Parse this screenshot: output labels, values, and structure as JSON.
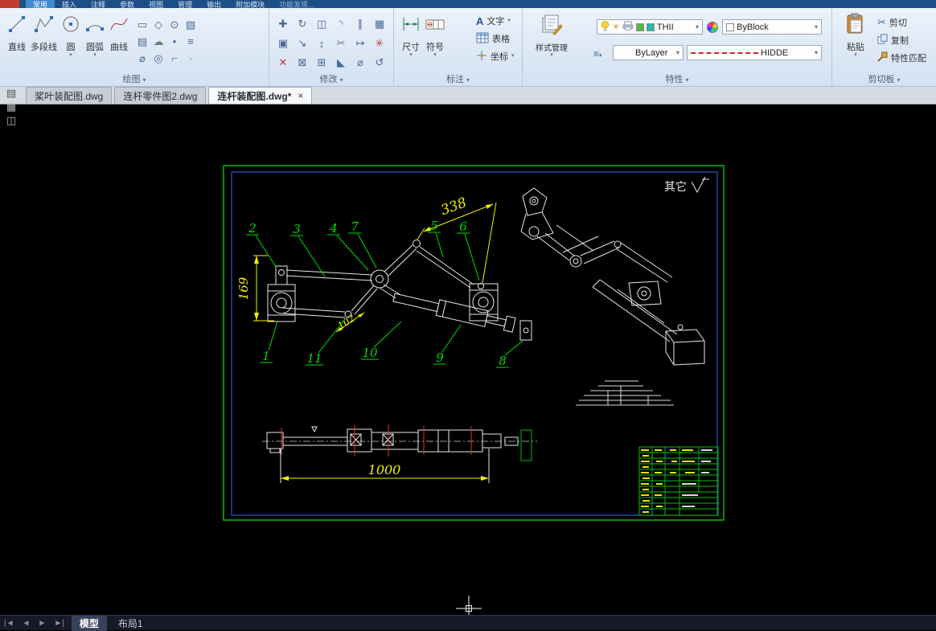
{
  "top_bar": {
    "tabs": [
      {
        "label": "常用",
        "active": true
      },
      {
        "label": "插入",
        "active": false
      },
      {
        "label": "注释",
        "active": false
      },
      {
        "label": "参数",
        "active": false
      },
      {
        "label": "视图",
        "active": false
      },
      {
        "label": "管理",
        "active": false
      },
      {
        "label": "输出",
        "active": false
      },
      {
        "label": "附加模块",
        "active": false
      },
      {
        "label": "功能发现...",
        "active": false
      }
    ]
  },
  "ribbon": {
    "draw": {
      "label": "绘图",
      "line": "直线",
      "polyline": "多段线",
      "circle": "圆",
      "arc": "圆弧",
      "spline": "曲线"
    },
    "modify": {
      "label": "修改"
    },
    "annotate": {
      "label": "标注",
      "dim": "尺寸",
      "symbol": "符号",
      "text": "文字",
      "table": "表格",
      "coord": "坐标"
    },
    "props": {
      "label": "特性",
      "style_mgr": "样式管理",
      "layer": "THII",
      "color": "ByBlock",
      "linetype": "ByLayer",
      "lt2": "HIDDE"
    },
    "clip": {
      "label": "剪切板",
      "paste": "粘贴",
      "cut": "剪切",
      "copy": "复制",
      "match": "特性匹配"
    }
  },
  "file_tabs": {
    "t1": "桨叶装配图.dwg",
    "t2": "连杆零件图2.dwg",
    "t3": "连杆装配图.dwg*",
    "close": "×"
  },
  "drawing": {
    "other": "其它",
    "dims": {
      "d338": "338",
      "d169": "169",
      "d102": "102",
      "d1000": "1000"
    },
    "callouts": {
      "c1": "1",
      "c2": "2",
      "c3": "3",
      "c4": "4",
      "c5": "5",
      "c6": "6",
      "c7": "7",
      "c8": "8",
      "c9": "9",
      "c10": "10",
      "c11": "11"
    }
  },
  "status": {
    "model": "模型",
    "layout1": "布局1"
  },
  "colors": {
    "frame_green": "#00c000",
    "inner_frame_blue": "#2456c8",
    "dim_yellow": "#f2f200",
    "callout_green": "#00dd00",
    "centerline_red": "#e03030",
    "entity_white": "#e8e8e8"
  }
}
